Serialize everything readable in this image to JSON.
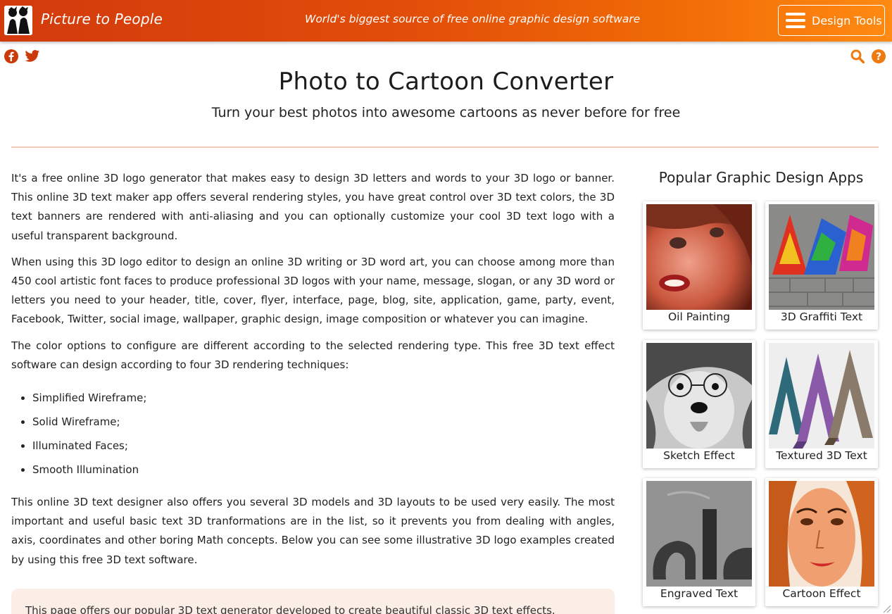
{
  "header": {
    "brand": "Picture to People",
    "tagline": "World's biggest source of free online graphic design software",
    "menu_button_label": "Design Tools"
  },
  "social": {
    "facebook_icon": "facebook-icon",
    "twitter_icon": "twitter-icon"
  },
  "tools": {
    "search_icon": "search-icon",
    "help_icon": "help-icon"
  },
  "page": {
    "title": "Photo to Cartoon Converter",
    "subtitle": "Turn your best photos into awesome cartoons as never before for free"
  },
  "content": {
    "p1": "It's a free online 3D logo generator that makes easy to design 3D letters and words to your 3D logo or banner. This online 3D text maker app offers several rendering styles, you have great control over 3D text colors, the 3D text banners are rendered with anti-aliasing and you can optionally customize your cool 3D text logo with a useful transparent background.",
    "p2": "When using this 3D logo editor to design an online 3D writing or 3D word art, you can choose among more than 450 cool artistic font faces to produce professional 3D logos with your name, message, slogan, or any 3D word or letters you need to your header, title, cover, flyer, interface, page, blog, site, application, game, party, event, Facebook, Twitter, social image, wallpaper, graphic design, image composition or whatever you can imagine.",
    "p3": "The color options to configure are different according to the selected rendering type. This free 3D text effect software can design according to four 3D rendering techniques:",
    "list": [
      "Simplified Wireframe;",
      "Solid Wireframe;",
      "Illuminated Faces;",
      "Smooth Illumination"
    ],
    "p4": "This online 3D text designer also offers you several 3D models and 3D layouts to be used very easily. The most important and useful basic text 3D tranformations are in the list, so it prevents you from dealing with angles, axis, coordinates and other boring Math concepts. Below you can see some illustrative 3D logo examples created by using this free 3D text software.",
    "notice": "This page offers our popular 3D text generator developed to create beautiful classic 3D text effects."
  },
  "sidebar": {
    "title": "Popular Graphic Design Apps",
    "apps": [
      {
        "label": "Oil Painting"
      },
      {
        "label": "3D Graffiti Text"
      },
      {
        "label": "Sketch Effect"
      },
      {
        "label": "Textured 3D Text"
      },
      {
        "label": "Engraved Text"
      },
      {
        "label": "Cartoon Effect"
      }
    ]
  },
  "colors": {
    "brand_orange": "#e24d0a",
    "accent_orange": "#f07a10",
    "divider": "#efc9b6",
    "notice_bg": "#fbeee6"
  }
}
